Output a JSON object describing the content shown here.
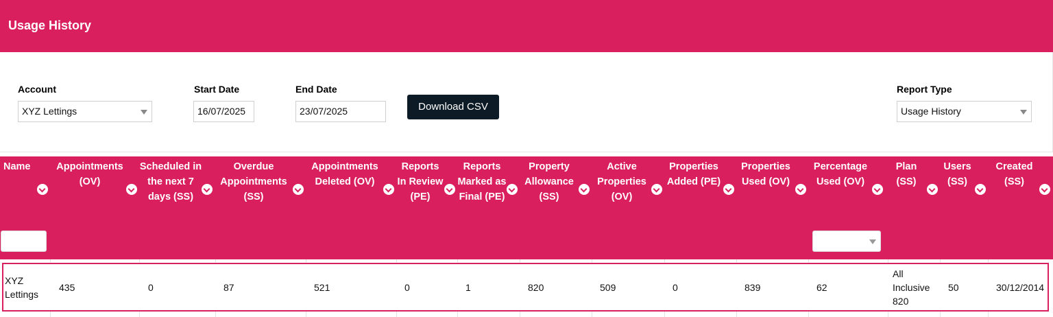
{
  "header": {
    "title": "Usage History"
  },
  "filters": {
    "account_label": "Account",
    "account_value": "XYZ Lettings",
    "start_label": "Start Date",
    "start_value": "16/07/2025",
    "end_label": "End Date",
    "end_value": "23/07/2025",
    "download_label": "Download CSV",
    "report_type_label": "Report Type",
    "report_type_value": "Usage History"
  },
  "table": {
    "columns": [
      "Name",
      "Appointments (OV)",
      "Scheduled in the next 7 days (SS)",
      "Overdue Appointments (SS)",
      "Appointments Deleted (OV)",
      "Reports In Review (PE)",
      "Reports Marked as Final (PE)",
      "Property Allowance (SS)",
      "Active Properties (OV)",
      "Properties Added (PE)",
      "Properties Used (OV)",
      "Percentage Used (OV)",
      "Plan (SS)",
      "Users (SS)",
      "Created (SS)"
    ],
    "rows": [
      [
        "XYZ Lettings",
        "435",
        "0",
        "87",
        "521",
        "0",
        "1",
        "820",
        "509",
        "0",
        "839",
        "62",
        "All Inclusive 820",
        "50",
        "30/12/2014"
      ]
    ]
  },
  "colors": {
    "accent": "#d91f5d",
    "button": "#0d1b26"
  }
}
